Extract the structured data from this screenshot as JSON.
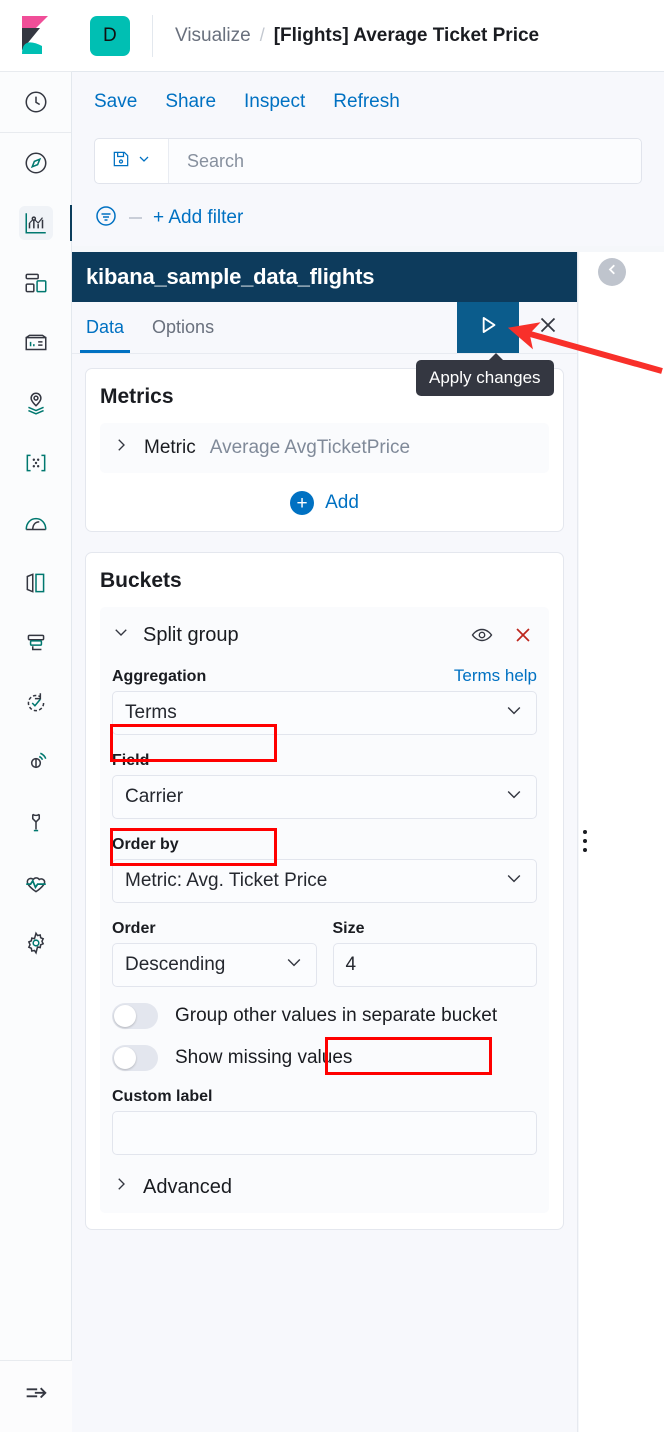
{
  "app": {
    "logo_icon": "kibana-logo",
    "space_avatar_letter": "D"
  },
  "breadcrumb": {
    "parent": "Visualize",
    "separator": "/",
    "current": "[Flights] Average Ticket Price"
  },
  "actions": [
    {
      "label": "Save",
      "name": "save-button"
    },
    {
      "label": "Share",
      "name": "share-button"
    },
    {
      "label": "Inspect",
      "name": "inspect-button"
    },
    {
      "label": "Refresh",
      "name": "refresh-button"
    }
  ],
  "query_bar": {
    "saved_query_icon": "save-disk-icon",
    "saved_query_chevron": "chevron-down-icon",
    "search_placeholder": "Search",
    "search_value": ""
  },
  "filter_bar": {
    "filter_icon": "filter-icon",
    "add_filter_label": "+ Add filter"
  },
  "editor": {
    "index_pattern_title": "kibana_sample_data_flights",
    "tabs": [
      {
        "label": "Data",
        "active": true
      },
      {
        "label": "Options",
        "active": false
      }
    ],
    "apply_icon": "play-icon",
    "close_icon": "close-icon",
    "tooltip": "Apply changes",
    "collapse_icon": "chevron-left-icon",
    "drag_handle_icon": "grip-vertical-icon"
  },
  "metrics": {
    "title": "Metrics",
    "rows": [
      {
        "expand_icon": "chevron-right-icon",
        "kind": "Metric",
        "value": "Average AvgTicketPrice"
      }
    ],
    "add_label": "Add",
    "add_icon": "plus-circle-icon"
  },
  "buckets": {
    "title": "Buckets",
    "group": {
      "collapse_icon": "chevron-down-icon",
      "name": "Split group",
      "toggle_visibility_icon": "eye-icon",
      "remove_icon": "close-x-icon"
    },
    "aggregation": {
      "label": "Aggregation",
      "help_link": "Terms help",
      "value": "Terms",
      "chevron": "chevron-down-icon",
      "highlighted": true
    },
    "field": {
      "label": "Field",
      "value": "Carrier",
      "chevron": "chevron-down-icon",
      "highlighted": true
    },
    "order_by": {
      "label": "Order by",
      "value": "Metric: Avg. Ticket Price",
      "chevron": "chevron-down-icon"
    },
    "order": {
      "label": "Order",
      "value": "Descending",
      "chevron": "chevron-down-icon"
    },
    "size": {
      "label": "Size",
      "value": "4",
      "highlighted": true
    },
    "toggles": [
      {
        "label": "Group other values in separate bucket",
        "on": false
      },
      {
        "label": "Show missing values",
        "on": false
      }
    ],
    "custom_label": {
      "label": "Custom label",
      "value": "",
      "placeholder": ""
    },
    "advanced": {
      "label": "Advanced",
      "expand_icon": "chevron-right-icon"
    }
  },
  "sidebar": {
    "items": [
      {
        "name": "recently-viewed",
        "icon": "clock-icon",
        "active": false
      },
      {
        "name": "discover",
        "icon": "compass-icon",
        "active": false
      },
      {
        "name": "visualize",
        "icon": "chart-icon",
        "active": true
      },
      {
        "name": "dashboard",
        "icon": "dashboard-icon",
        "active": false
      },
      {
        "name": "canvas",
        "icon": "canvas-icon",
        "active": false
      },
      {
        "name": "maps",
        "icon": "map-pin-layers-icon",
        "active": false
      },
      {
        "name": "machine-learning",
        "icon": "ml-nodes-icon",
        "active": false
      },
      {
        "name": "infrastructure",
        "icon": "infrastructure-icon",
        "active": false
      },
      {
        "name": "logs",
        "icon": "logs-icon",
        "active": false
      },
      {
        "name": "apm",
        "icon": "apm-icon",
        "active": false
      },
      {
        "name": "uptime",
        "icon": "uptime-check-icon",
        "active": false
      },
      {
        "name": "siem",
        "icon": "siem-icon",
        "active": false
      },
      {
        "name": "dev-tools",
        "icon": "wrench-icon",
        "active": false
      },
      {
        "name": "monitoring",
        "icon": "heartbeat-icon",
        "active": false
      },
      {
        "name": "management",
        "icon": "gear-icon",
        "active": false
      }
    ],
    "collapse_toggle_icon": "menu-expand-icon"
  },
  "annotation": {
    "highlight_color": "#FF0000",
    "arrow_color": "#F8302A"
  }
}
